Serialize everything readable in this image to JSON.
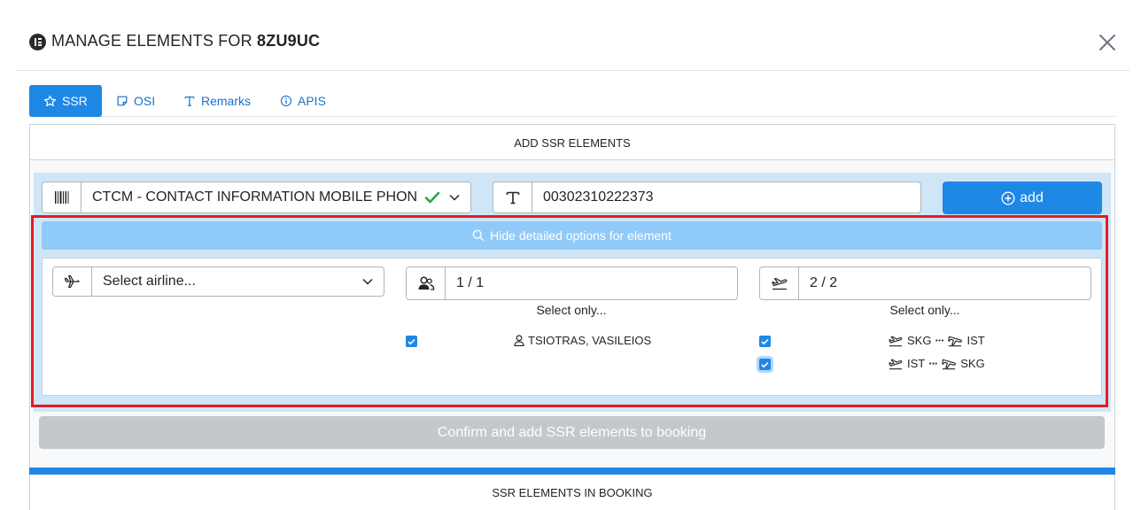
{
  "header": {
    "title_prefix": "MANAGE ELEMENTS FOR",
    "booking_ref": "8ZU9UC",
    "icon": "elementor-icon",
    "close_icon": "close-icon"
  },
  "tabs": [
    {
      "label": "SSR",
      "icon": "star-icon",
      "active": true
    },
    {
      "label": "OSI",
      "icon": "note-icon",
      "active": false
    },
    {
      "label": "Remarks",
      "icon": "text-icon",
      "active": false
    },
    {
      "label": "APIS",
      "icon": "info-icon",
      "active": false
    }
  ],
  "add_section": {
    "title": "ADD SSR ELEMENTS",
    "ssr_select": {
      "value": "CTCM - CONTACT INFORMATION MOBILE PHONE NUMBER",
      "icon": "barcode-icon",
      "valid": true
    },
    "text_input": {
      "value": "00302310222373",
      "icon": "text-icon"
    },
    "add_button": "add",
    "hide_options": "Hide detailed options for element",
    "airline_select": {
      "placeholder": "Select airline...",
      "icon": "airplane-icon"
    },
    "passengers": {
      "count": "1 / 1",
      "select_only": "Select only...",
      "items": [
        {
          "name": "TSIOTRAS, VASILEIOS",
          "checked": true
        }
      ]
    },
    "segments": {
      "count": "2 / 2",
      "select_only": "Select only...",
      "items": [
        {
          "from": "SKG",
          "to": "IST",
          "checked": true
        },
        {
          "from": "IST",
          "to": "SKG",
          "checked": true
        }
      ]
    },
    "confirm_button": "Confirm and add SSR elements to booking"
  },
  "booking_section": {
    "title": "SSR ELEMENTS IN BOOKING"
  },
  "colors": {
    "accent": "#1e88e5",
    "highlight": "#e31b23",
    "success": "#28a745",
    "disabled": "#c3c8cc"
  }
}
